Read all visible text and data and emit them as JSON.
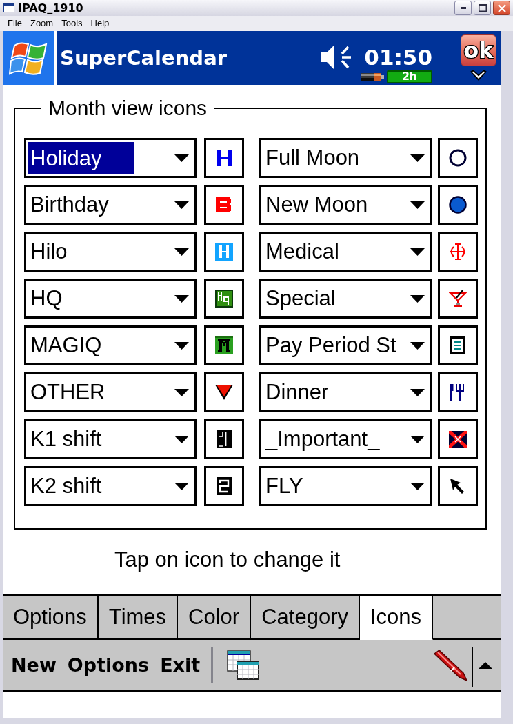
{
  "window": {
    "title": "IPAQ_1910",
    "menu": [
      "File",
      "Zoom",
      "Tools",
      "Help"
    ]
  },
  "header": {
    "title": "SuperCalendar",
    "time": "01:50",
    "battery_time": "2h",
    "ok_button": "ok"
  },
  "month_view_icons": {
    "title": "Month view icons",
    "left_column": [
      {
        "value": "Holiday",
        "selected": true
      },
      {
        "value": "Birthday",
        "selected": false
      },
      {
        "value": "Hilo",
        "selected": false
      },
      {
        "value": "HQ",
        "selected": false
      },
      {
        "value": "MAGIQ",
        "selected": false
      },
      {
        "value": "OTHER",
        "selected": false
      },
      {
        "value": "K1 shift",
        "selected": false
      },
      {
        "value": "K2 shift",
        "selected": false
      }
    ],
    "right_column": [
      {
        "value": "Full Moon",
        "selected": false
      },
      {
        "value": "New Moon",
        "selected": false
      },
      {
        "value": "Medical",
        "selected": false
      },
      {
        "value": "Special",
        "selected": false
      },
      {
        "value": "Pay Period St",
        "selected": false
      },
      {
        "value": "Dinner",
        "selected": false
      },
      {
        "value": "_Important_",
        "selected": false
      },
      {
        "value": "FLY",
        "selected": false
      }
    ]
  },
  "hint": "Tap on icon to change it",
  "tabs": [
    {
      "label": "Options",
      "selected": false
    },
    {
      "label": "Times",
      "selected": false
    },
    {
      "label": "Color",
      "selected": false
    },
    {
      "label": "Category",
      "selected": false
    },
    {
      "label": "Icons",
      "selected": true
    }
  ],
  "command_bar": [
    "New",
    "Options",
    "Exit"
  ]
}
